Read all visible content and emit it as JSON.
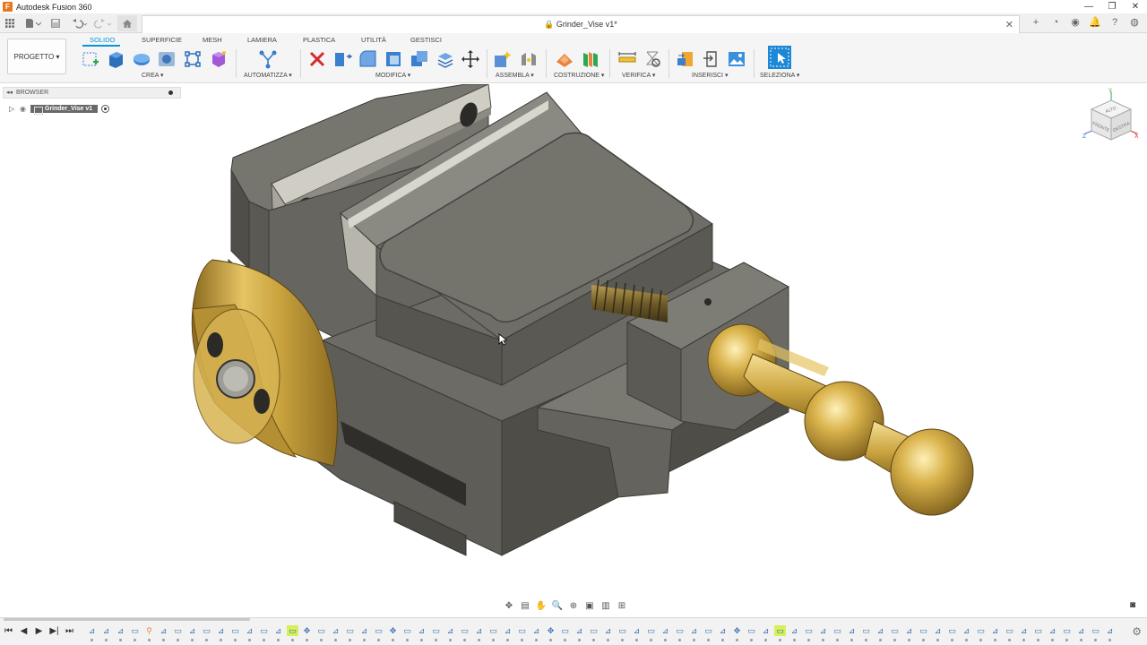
{
  "app": {
    "title": "Autodesk Fusion 360",
    "icon_letter": "F"
  },
  "window_controls": {
    "minimize": "—",
    "maximize": "❐",
    "close": "✕"
  },
  "document": {
    "tab_title": "Grinder_Vise v1*",
    "close_glyph": "✕"
  },
  "workspace": {
    "label": "PROGETTO ▾"
  },
  "tabs": [
    "SOLIDO",
    "SUPERFICIE",
    "MESH",
    "LAMIERA",
    "PLASTICA",
    "UTILITÀ",
    "GESTISCI"
  ],
  "active_tab": "SOLIDO",
  "groups": {
    "crea": "CREA ▾",
    "automatizza": "AUTOMATIZZA ▾",
    "modifica": "MODIFICA ▾",
    "assembla": "ASSEMBLA ▾",
    "costruzione": "COSTRUZIONE ▾",
    "verifica": "VERIFICA ▾",
    "inserisci": "INSERISCI ▾",
    "seleziona": "SELEZIONA ▾"
  },
  "browser": {
    "header": "BROWSER",
    "collapse_glyph": "◂◂",
    "root_item": "Grinder_Vise v1"
  },
  "viewcube": {
    "top": "ALTO",
    "front": "FRONTE",
    "right": "DESTRA",
    "axis_x": "X",
    "axis_y": "Y",
    "axis_z": "Z"
  },
  "colors": {
    "accent": "#0696d7",
    "body_gray": "#5f5e58",
    "brass": "#c9a33e",
    "timeline_highlight": "#d6f05a"
  },
  "timeline": {
    "controls": [
      "⏮",
      "◀",
      "▶",
      "▶|",
      "⏭"
    ],
    "items": [
      "sketch",
      "sketch",
      "sketch",
      "extrude",
      "joint",
      "sketch",
      "extrude",
      "sketch",
      "extrude",
      "sketch",
      "extrude",
      "sketch",
      "extrude",
      "sketch",
      "extrude",
      "move",
      "extrude",
      "sketch",
      "extrude",
      "sketch",
      "extrude",
      "move",
      "extrude",
      "sketch",
      "extrude",
      "sketch",
      "extrude",
      "sketch",
      "extrude",
      "sketch",
      "extrude",
      "sketch",
      "move",
      "extrude",
      "sketch",
      "extrude",
      "sketch",
      "extrude",
      "sketch",
      "extrude",
      "sketch",
      "extrude",
      "sketch",
      "extrude",
      "sketch",
      "move",
      "extrude",
      "sketch",
      "extrude",
      "sketch",
      "extrude",
      "sketch",
      "extrude",
      "sketch",
      "extrude",
      "sketch",
      "extrude",
      "sketch",
      "extrude",
      "sketch",
      "extrude",
      "sketch",
      "extrude",
      "sketch",
      "extrude",
      "sketch",
      "extrude",
      "sketch",
      "extrude",
      "sketch",
      "extrude",
      "sketch"
    ]
  }
}
